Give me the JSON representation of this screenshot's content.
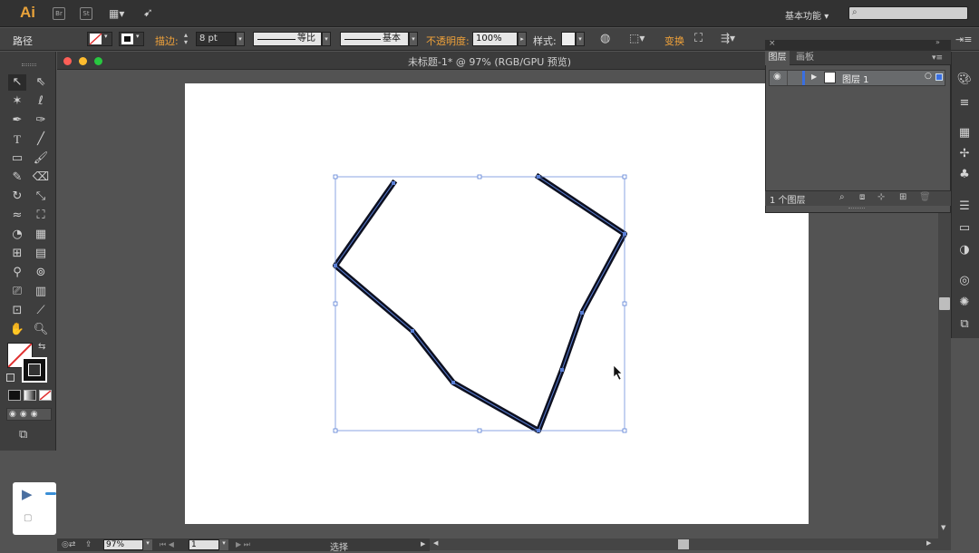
{
  "app": {
    "logo": "Ai",
    "icon_br": "Br",
    "icon_st": "St",
    "workspace": "基本功能"
  },
  "control": {
    "object_type": "路径",
    "stroke_label": "描边:",
    "stroke_value": "8 pt",
    "profile_label": "等比",
    "brush_label": "基本",
    "opacity_label": "不透明度:",
    "opacity_value": "100%",
    "style_label": "样式:",
    "transform_label": "变换"
  },
  "document": {
    "title": "未标题-1* @ 97% (RGB/GPU 预览)"
  },
  "layers_panel": {
    "tabs": [
      "图层",
      "画板"
    ],
    "layer_name": "图层 1",
    "count": "1 个图层"
  },
  "status": {
    "zoom": "97%",
    "artboard": "1",
    "tool": "选择"
  },
  "colors": {
    "accent": "#f0a23a",
    "selection": "#5a7fd6",
    "stroke": "#0d1020"
  }
}
